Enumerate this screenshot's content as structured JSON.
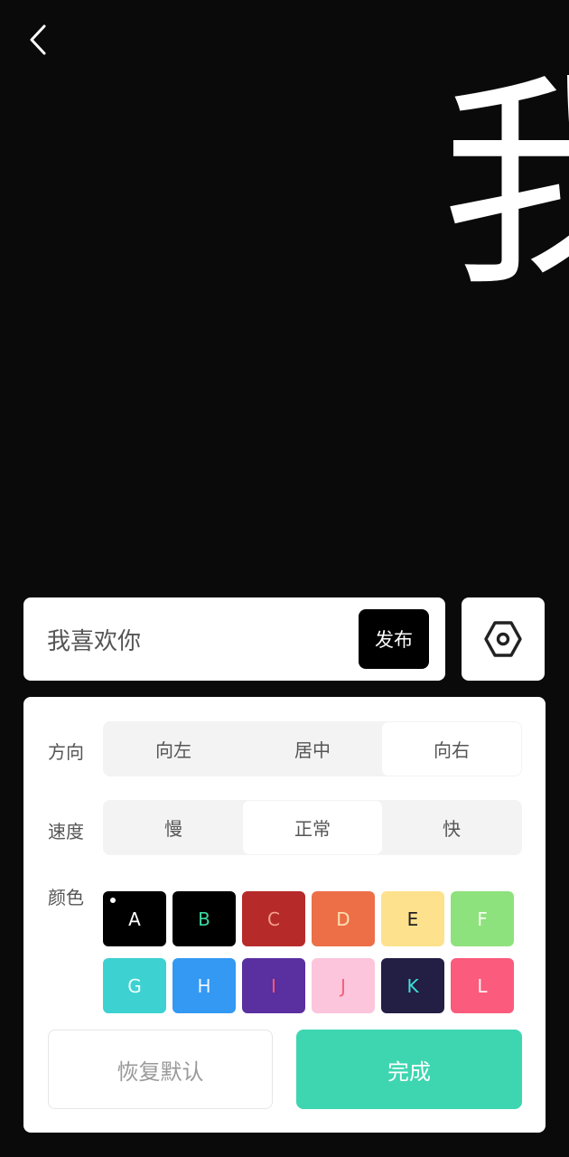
{
  "preview": {
    "text": "我"
  },
  "input": {
    "value": "我喜欢你",
    "publish_label": "发布"
  },
  "direction": {
    "label": "方向",
    "options": [
      "向左",
      "居中",
      "向右"
    ],
    "selected": "向右"
  },
  "speed": {
    "label": "速度",
    "options": [
      "慢",
      "正常",
      "快"
    ],
    "selected": "正常"
  },
  "color": {
    "label": "颜色",
    "selected": "A",
    "swatches": [
      {
        "letter": "A",
        "bg": "#000000",
        "fg": "#ffffff"
      },
      {
        "letter": "B",
        "bg": "#000000",
        "fg": "#3dd6a0"
      },
      {
        "letter": "C",
        "bg": "#b62a2a",
        "fg": "#f4a090"
      },
      {
        "letter": "D",
        "bg": "#ec6f48",
        "fg": "#fde0b0"
      },
      {
        "letter": "E",
        "bg": "#fde18c",
        "fg": "#222222"
      },
      {
        "letter": "F",
        "bg": "#8ee27d",
        "fg": "#f4fff0"
      },
      {
        "letter": "G",
        "bg": "#3ed1d1",
        "fg": "#eaffff"
      },
      {
        "letter": "H",
        "bg": "#3399f3",
        "fg": "#eaf4ff"
      },
      {
        "letter": "I",
        "bg": "#5a2f9f",
        "fg": "#ff5a6a"
      },
      {
        "letter": "J",
        "bg": "#fcc5dc",
        "fg": "#f2607a"
      },
      {
        "letter": "K",
        "bg": "#231e44",
        "fg": "#40e0d8"
      },
      {
        "letter": "L",
        "bg": "#fb5b7c",
        "fg": "#fff0f3"
      }
    ]
  },
  "actions": {
    "reset_label": "恢复默认",
    "done_label": "完成"
  }
}
